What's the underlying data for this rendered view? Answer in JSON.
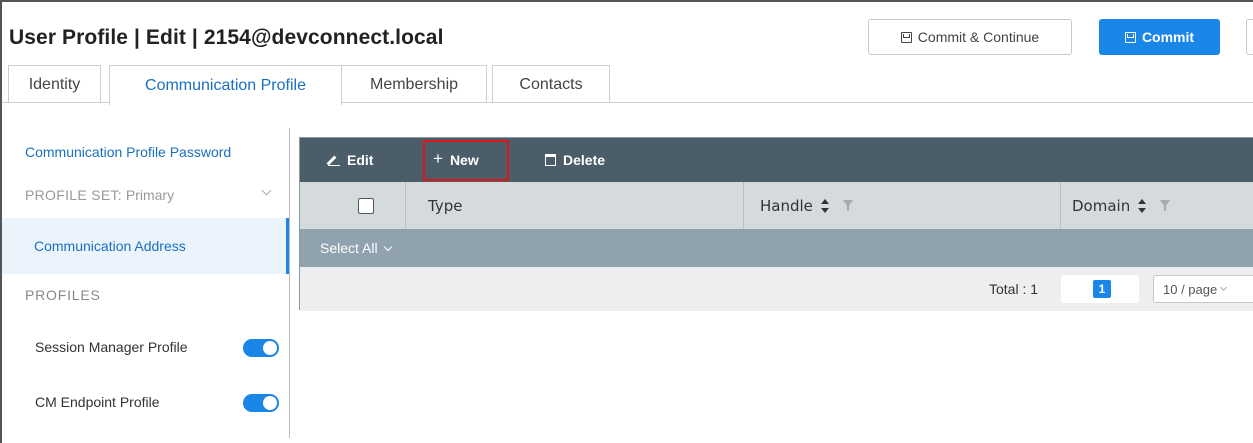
{
  "header": {
    "title": "User Profile | Edit | 2154@devconnect.local",
    "commit_continue_label": "Commit & Continue",
    "commit_label": "Commit"
  },
  "tabs": [
    {
      "label": "Identity",
      "active": false
    },
    {
      "label": "Communication Profile",
      "active": true
    },
    {
      "label": "Membership",
      "active": false
    },
    {
      "label": "Contacts",
      "active": false
    }
  ],
  "sidebar": {
    "password_link": "Communication Profile Password",
    "profile_set_label": "PROFILE SET:",
    "profile_set_value": "Primary",
    "communication_address": "Communication Address",
    "profiles_heading": "PROFILES",
    "profiles": [
      {
        "label": "Session Manager Profile",
        "enabled": true
      },
      {
        "label": "CM Endpoint Profile",
        "enabled": true
      }
    ]
  },
  "table": {
    "toolbar": {
      "edit_label": "Edit",
      "new_label": "New",
      "delete_label": "Delete"
    },
    "columns": [
      "Type",
      "Handle",
      "Domain"
    ],
    "select_all_label": "Select All",
    "total_label": "Total : 1",
    "current_page": "1",
    "page_size": "10 / page"
  },
  "colors": {
    "accent": "#1a86e8",
    "toolbar_bg": "#4b5d69",
    "highlight_box": "#e01515"
  }
}
